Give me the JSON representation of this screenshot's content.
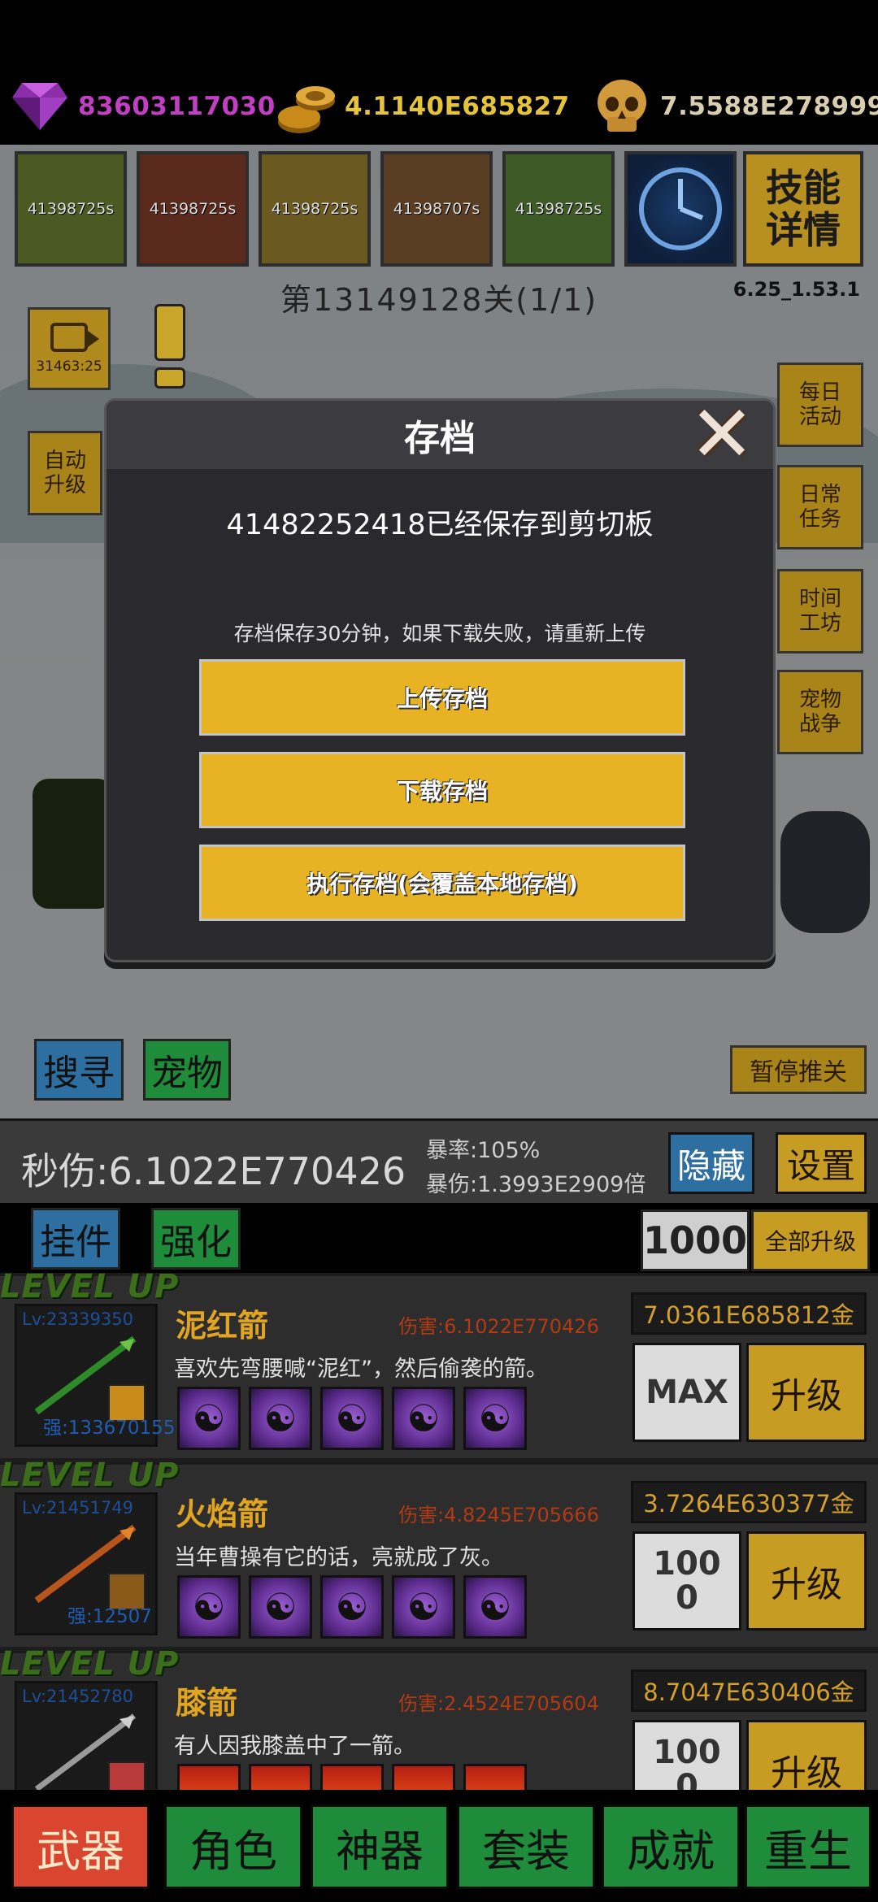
{
  "currency": {
    "gems": "83603117030",
    "gold": "4.1140E685827",
    "skulls": "7.5588E278999",
    "colors": {
      "gems": "#c23fc4",
      "gold": "#e6c43a",
      "skulls": "#d9cfb0"
    }
  },
  "skills": {
    "timers": [
      "41398725s",
      "41398725s",
      "41398725s",
      "41398707s",
      "41398725s"
    ],
    "detail_label": "技能详情"
  },
  "stage": {
    "title": "第13149128关(1/1)",
    "version": "6.25_1.53.1"
  },
  "scene": {
    "video_timer": "31463:25",
    "auto_upgrade": "自动升级",
    "side_buttons": [
      "每日活动",
      "日常任务",
      "时间工坊",
      "宠物战争"
    ],
    "search": "搜寻",
    "pet": "宠物",
    "pause": "暂停推关"
  },
  "dialog": {
    "title": "存档",
    "message": "41482252418已经保存到剪切板",
    "note": "存档保存30分钟，如果下载失败，请重新上传",
    "upload": "上传存档",
    "download": "下载存档",
    "execute": "执行存档(会覆盖本地存档)"
  },
  "stats": {
    "dps": "秒伤:6.1022E770426",
    "crit_rate": "暴率:105%",
    "crit_dmg": "暴伤:1.3993E2909倍",
    "hide": "隐藏",
    "settings": "设置"
  },
  "subtabs": {
    "hang": "挂件",
    "enhance": "强化",
    "qty": "1000",
    "upgrade_all": "全部升级"
  },
  "weapons": [
    {
      "levelup": "LEVEL UP",
      "lv": "Lv:23339350",
      "strength": "强:133670155",
      "name": "泥红箭",
      "damage": "伤害:6.1022E770426",
      "desc": "喜欢先弯腰喊“泥红”，然后偷袭的箭。",
      "price": "7.0361E685812金",
      "action": "MAX",
      "upgrade": "升级"
    },
    {
      "levelup": "LEVEL UP",
      "lv": "Lv:21451749",
      "strength": "强:12507",
      "name": "火焰箭",
      "damage": "伤害:4.8245E705666",
      "desc": "当年曹操有它的话，亮就成了灰。",
      "price": "3.7264E630377金",
      "action": "100\n0",
      "upgrade": "升级"
    },
    {
      "levelup": "LEVEL UP",
      "lv": "Lv:21452780",
      "strength": "",
      "name": "膝箭",
      "damage": "伤害:2.4524E705604",
      "desc": "有人因我膝盖中了一箭。",
      "price": "8.7047E630406金",
      "action": "100\n0",
      "upgrade": "升级"
    }
  ],
  "nav": [
    "武器",
    "角色",
    "神器",
    "套装",
    "成就",
    "重生"
  ]
}
